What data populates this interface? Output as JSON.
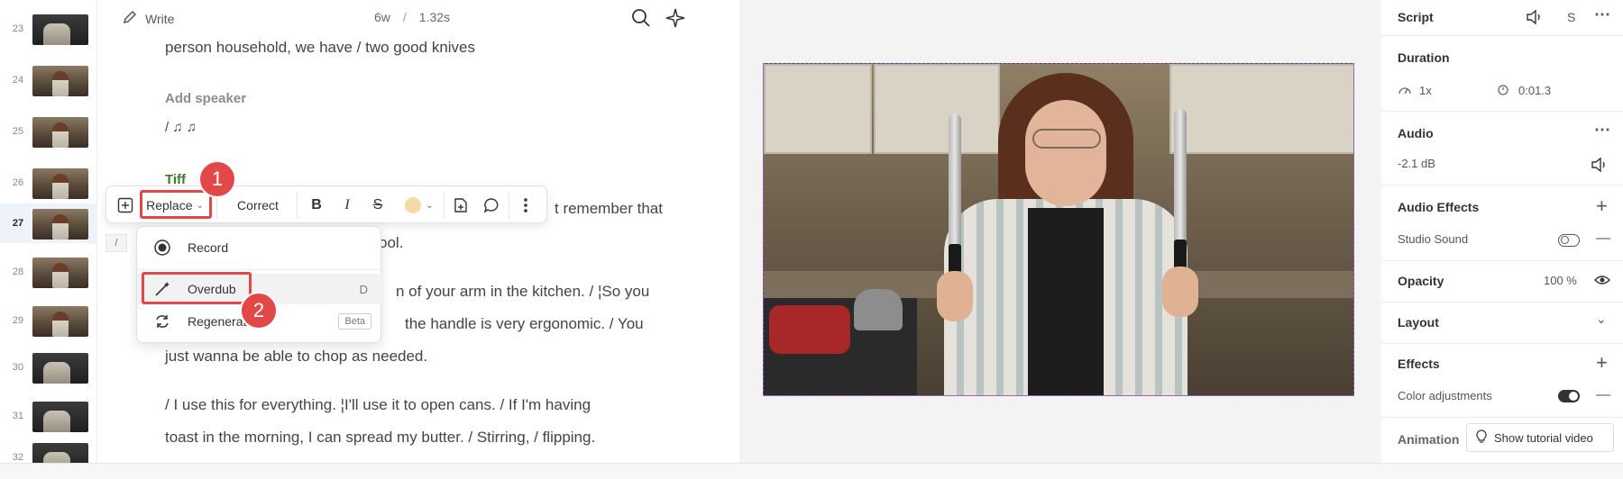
{
  "thumbnails": [
    {
      "num": "23"
    },
    {
      "num": "24"
    },
    {
      "num": "25"
    },
    {
      "num": "26"
    },
    {
      "num": "27"
    },
    {
      "num": "28"
    },
    {
      "num": "29"
    },
    {
      "num": "30"
    },
    {
      "num": "31"
    },
    {
      "num": "32"
    }
  ],
  "active_scene": "27",
  "topbar": {
    "write": "Write",
    "words": "6w",
    "sep": "/",
    "duration": "1.32s"
  },
  "transcript": {
    "line1": "person household, we have / two good knives",
    "add_speaker": "Add speaker",
    "line2": "/ ♫  ♫",
    "speaker": "Tiff",
    "line3_tail": "t remember that",
    "line4_tail": "ool.",
    "line5_tail": "n of your arm in the kitchen. / ¦So you",
    "line6_tail": "the handle is very ergonomic. / You",
    "line7": "just wanna be able to chop as needed.",
    "line8": "/ I use this for everything. ¦I'll use it to open cans.   / If I'm having",
    "line9": "toast in the morning, I can spread my butter. / Stirring,   / flipping.",
    "slash_marker": "/"
  },
  "toolbar": {
    "replace": "Replace",
    "correct": "Correct",
    "bold": "B",
    "italic": "I",
    "strike": "S",
    "highlight_color": "#f7d9a8"
  },
  "menu": {
    "record": "Record",
    "overdub": "Overdub",
    "overdub_shortcut": "D",
    "regenerate": "Regenerat",
    "beta": "Beta"
  },
  "badges": {
    "one": "1",
    "two": "2"
  },
  "props": {
    "script": "Script",
    "script_s": "S",
    "duration_title": "Duration",
    "speed": "1x",
    "time": "0:01.3",
    "audio_title": "Audio",
    "audio_db": "-2.1 dB",
    "audio_effects": "Audio Effects",
    "studio_sound": "Studio Sound",
    "opacity": "Opacity",
    "opacity_val": "100 %",
    "layout": "Layout",
    "effects": "Effects",
    "color_adjustments": "Color adjustments",
    "animation": "Animation",
    "tutorial": "Show tutorial video"
  },
  "colors": {
    "accent_red": "#e24848",
    "selection": "#9b59e0"
  }
}
